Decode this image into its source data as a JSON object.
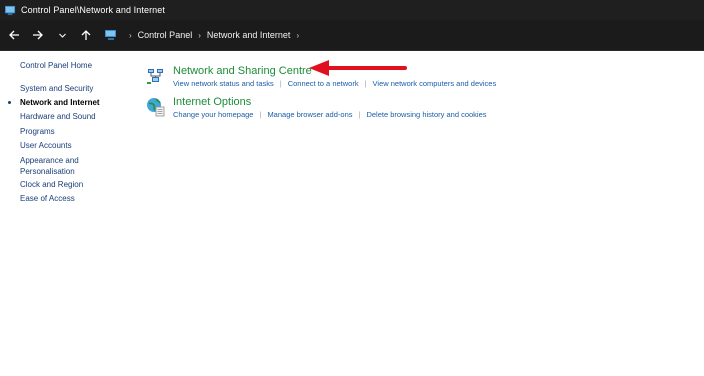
{
  "window": {
    "title": "Control Panel\\Network and Internet",
    "app_icon": "control-panel-icon"
  },
  "address_bar": {
    "location_icon": "control-panel-icon",
    "breadcrumbs": [
      "Control Panel",
      "Network and Internet"
    ]
  },
  "sidebar": {
    "home": "Control Panel Home",
    "items": [
      {
        "label": "System and Security"
      },
      {
        "label": "Network and Internet",
        "current": true
      },
      {
        "label": "Hardware and Sound"
      },
      {
        "label": "Programs"
      },
      {
        "label": "User Accounts"
      },
      {
        "label": "Appearance and",
        "label2": "Personalisation"
      },
      {
        "label": "Clock and Region"
      },
      {
        "label": "Ease of Access"
      }
    ]
  },
  "main": {
    "categories": [
      {
        "title": "Network and Sharing Centre",
        "icon": "network-sharing-icon",
        "links": [
          "View network status and tasks",
          "Connect to a network",
          "View network computers and devices"
        ]
      },
      {
        "title": "Internet Options",
        "icon": "internet-options-icon",
        "links": [
          "Change your homepage",
          "Manage browser add-ons",
          "Delete browsing history and cookies"
        ]
      }
    ]
  },
  "annotation": {
    "arrow_color": "#e01020"
  },
  "colors": {
    "title_bar": "#1f1f1f",
    "category_title": "#1e8c3a",
    "link": "#1a5ea8",
    "sidebar_link": "#1a3e7a"
  }
}
